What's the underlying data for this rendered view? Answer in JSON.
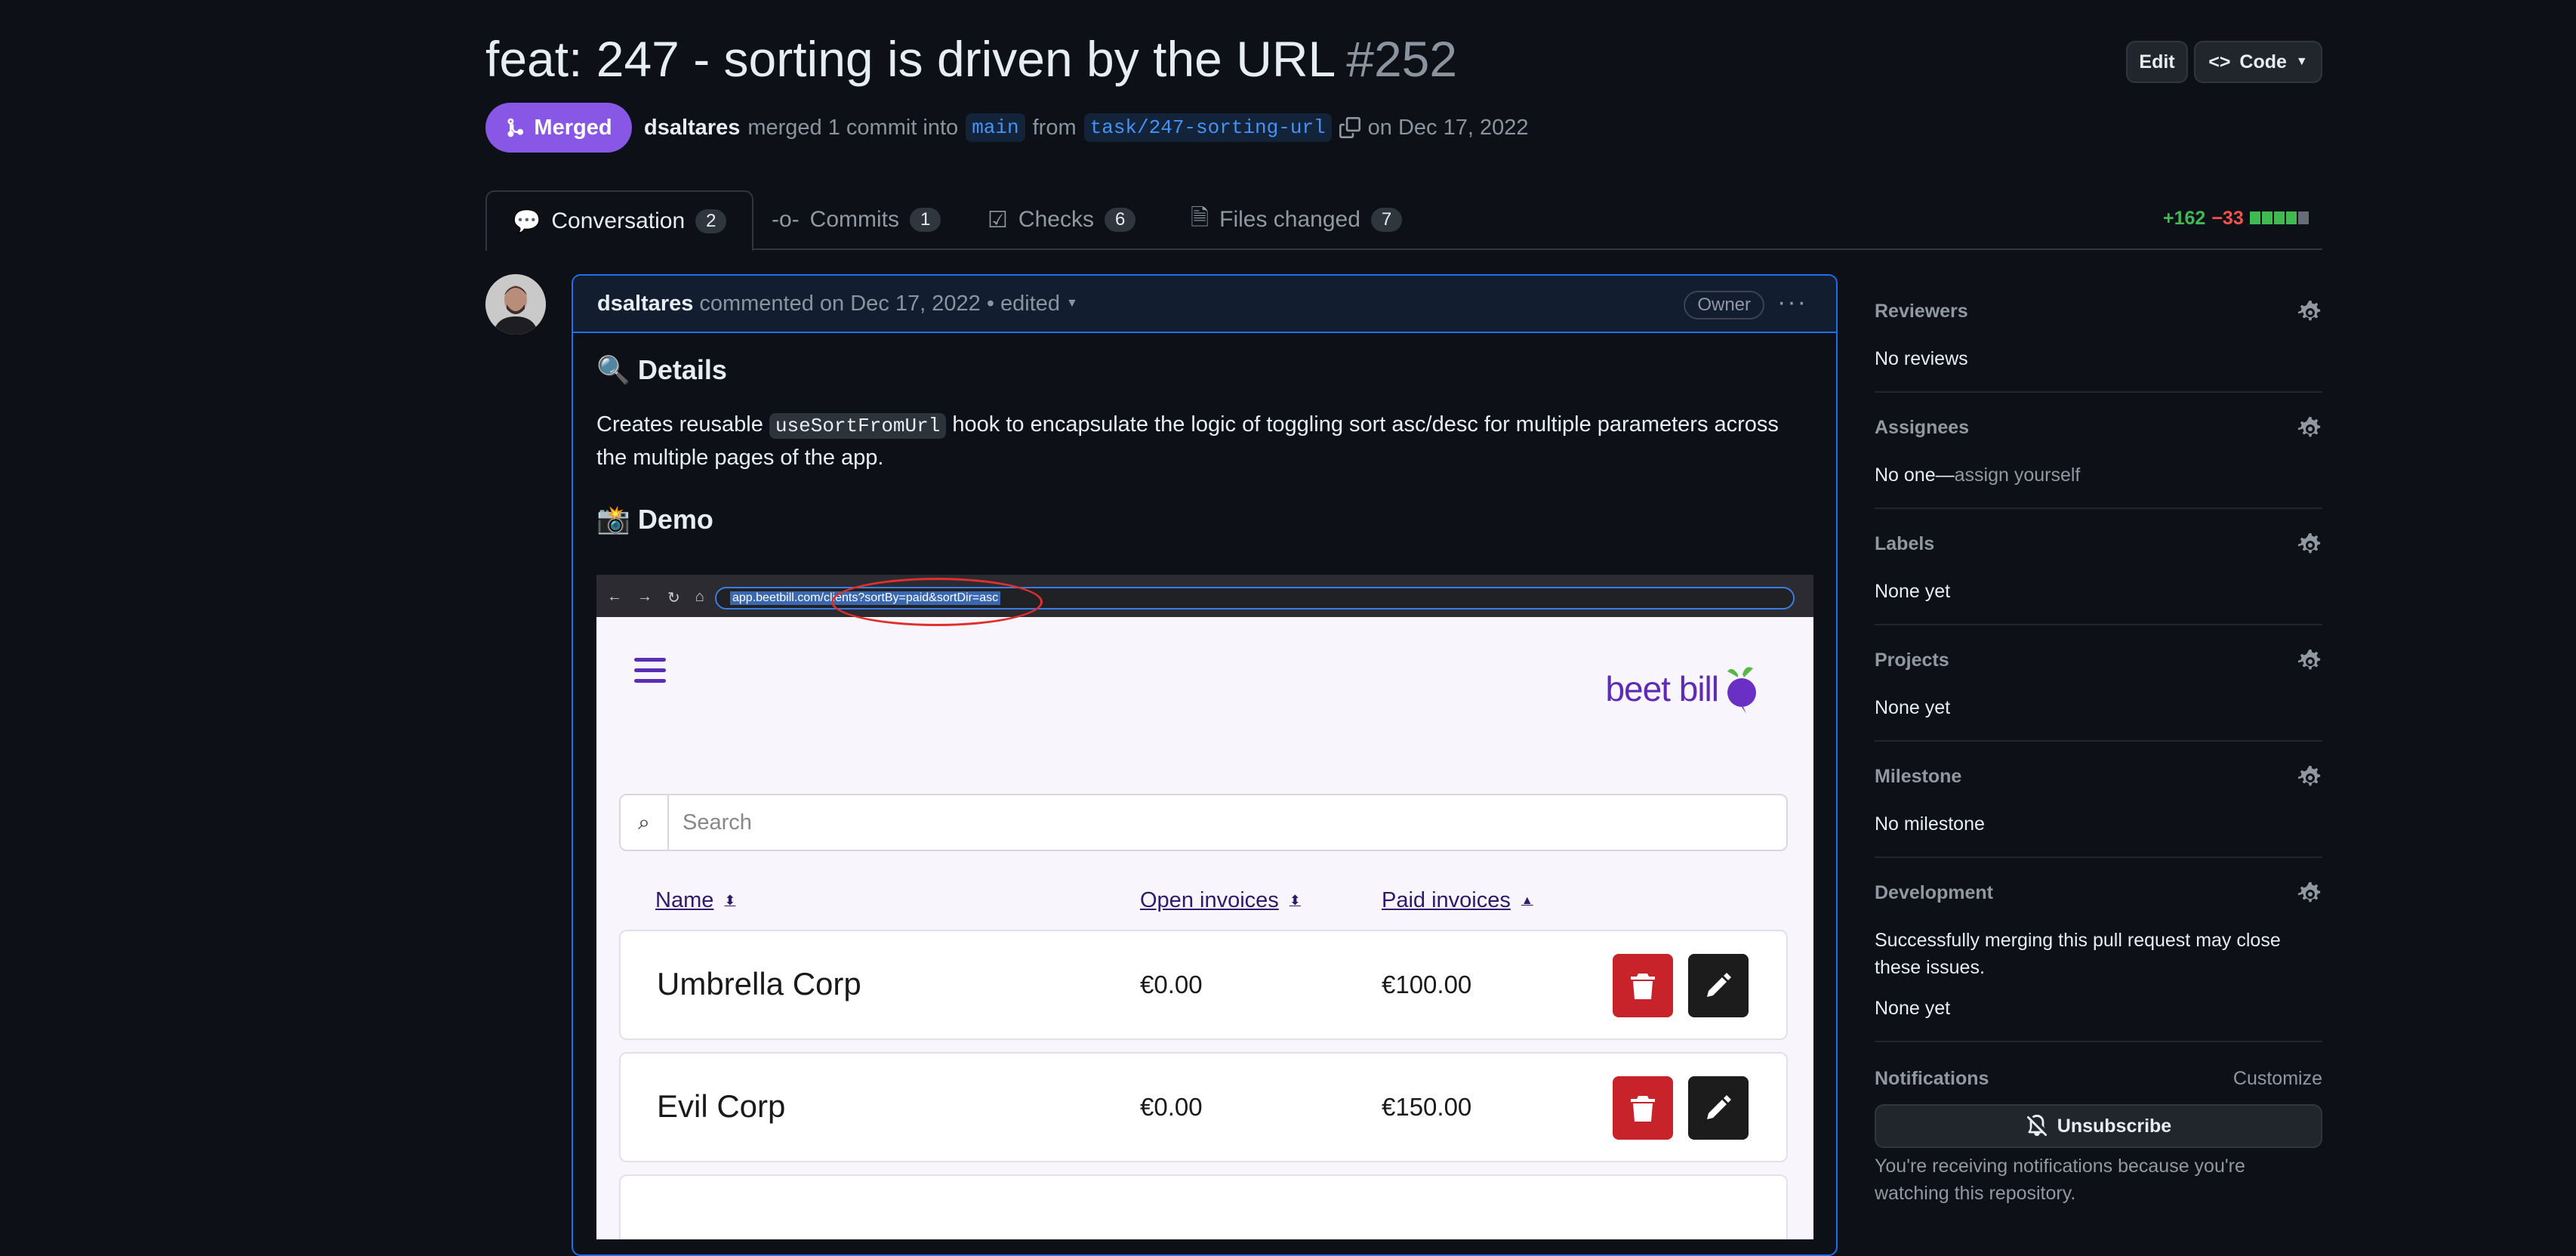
{
  "pr": {
    "title": "feat: 247 - sorting is driven by the URL",
    "number": "#252",
    "state": "Merged",
    "author": "dsaltares",
    "merged_text": "merged 1 commit into",
    "base_branch": "main",
    "from_text": "from",
    "head_branch": "task/247-sorting-url",
    "date_text": "on Dec 17, 2022"
  },
  "actions": {
    "edit": "Edit",
    "code": "Code"
  },
  "tabs": [
    {
      "label": "Conversation",
      "count": "2"
    },
    {
      "label": "Commits",
      "count": "1"
    },
    {
      "label": "Checks",
      "count": "6"
    },
    {
      "label": "Files changed",
      "count": "7"
    }
  ],
  "diffstat": {
    "additions": "+162",
    "deletions": "−33"
  },
  "comment": {
    "author": "dsaltares",
    "meta": "commented on Dec 17, 2022 • edited",
    "badge": "Owner",
    "details_heading": "Details",
    "para_1": "Creates reusable",
    "code": "useSortFromUrl",
    "para_2": "hook to encapsulate the logic of toggling sort asc/desc for multiple parameters across",
    "para_3": "the multiple pages of the app.",
    "demo_heading": "Demo"
  },
  "demo": {
    "url_host": "app.beetbill.co",
    "url_path": "m/clients?sortBy=paid&sortDir=asc",
    "logo": "beet bill",
    "search_placeholder": "Search",
    "columns": {
      "name": "Name",
      "open": "Open invoices",
      "paid": "Paid invoices"
    },
    "rows": [
      {
        "name": "Umbrella Corp",
        "open": "€0.00",
        "paid": "€100.00"
      },
      {
        "name": "Evil Corp",
        "open": "€0.00",
        "paid": "€150.00"
      }
    ]
  },
  "sidebar": {
    "reviewers": {
      "label": "Reviewers",
      "value": "No reviews"
    },
    "assignees": {
      "label": "Assignees",
      "value": "No one—",
      "link": "assign yourself"
    },
    "labels": {
      "label": "Labels",
      "value": "None yet"
    },
    "projects": {
      "label": "Projects",
      "value": "None yet"
    },
    "milestone": {
      "label": "Milestone",
      "value": "No milestone"
    },
    "development": {
      "label": "Development",
      "desc": "Successfully merging this pull request may close these issues.",
      "value": "None yet"
    },
    "notifications": {
      "label": "Notifications",
      "customize": "Customize",
      "unsubscribe": "Unsubscribe",
      "reason": "You're receiving notifications because you're watching this repository."
    }
  },
  "colors": {
    "merged": "#8957e5",
    "accent": "#1f6feb",
    "delete": "#c8232b"
  }
}
